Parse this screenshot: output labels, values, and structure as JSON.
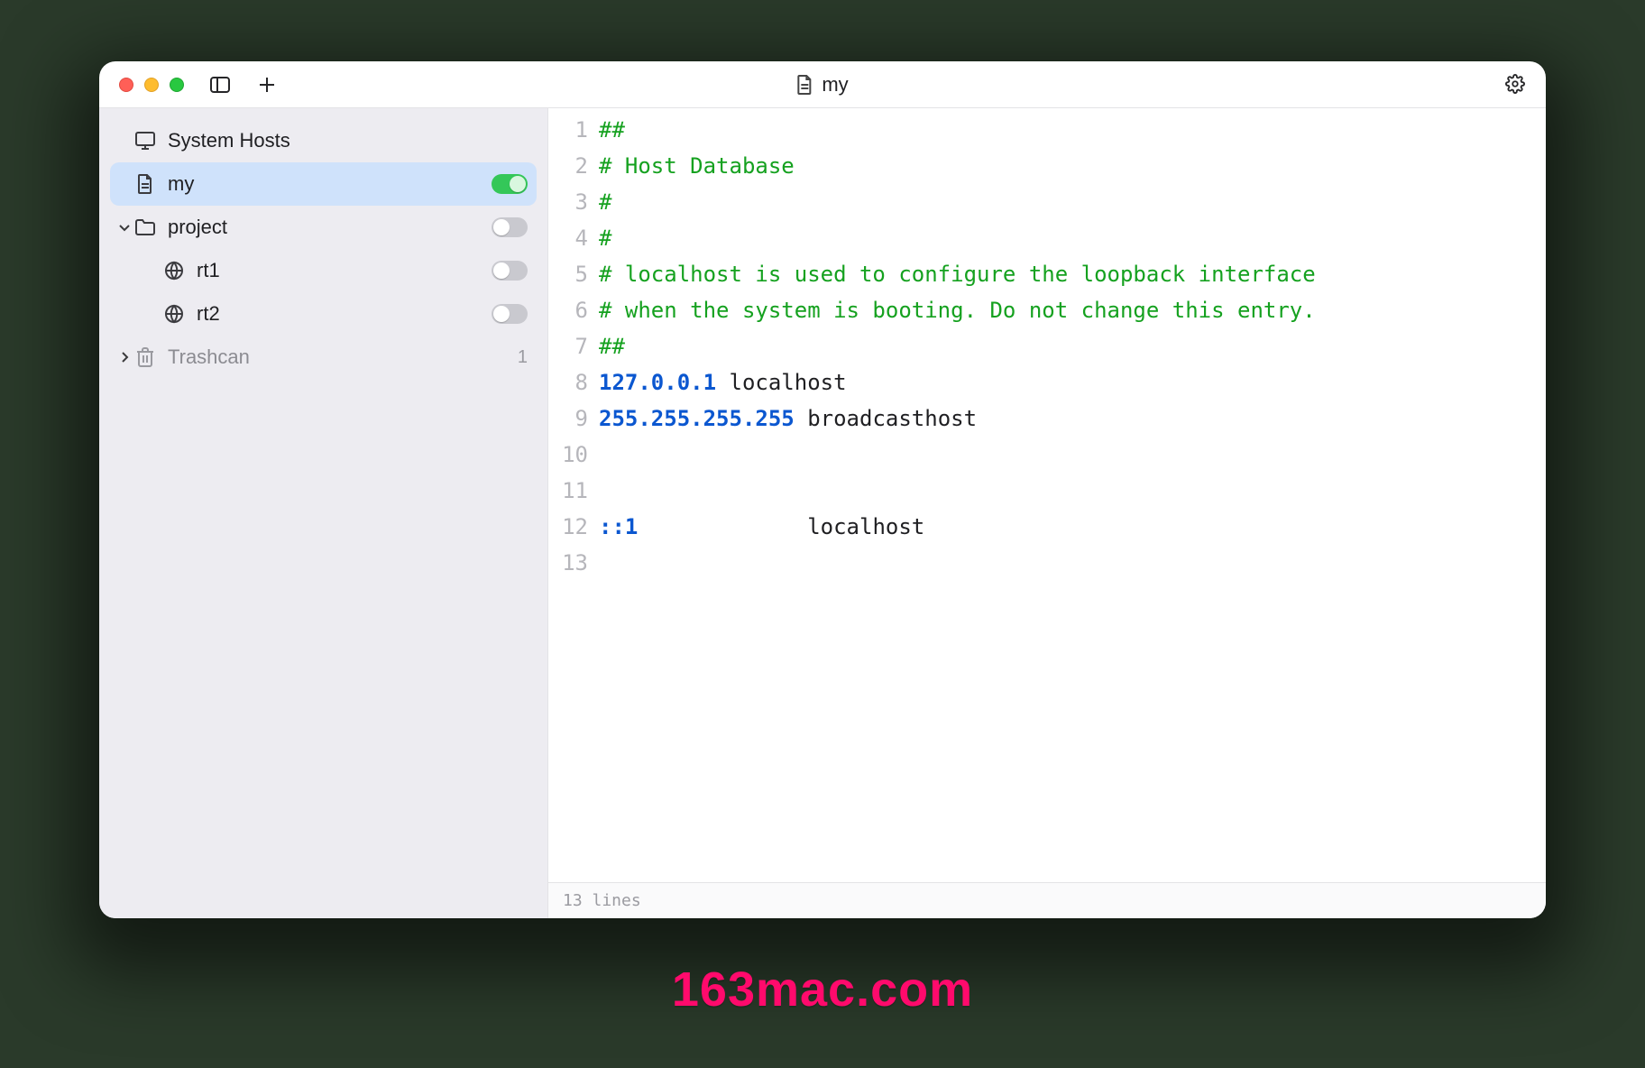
{
  "titlebar": {
    "title": "my"
  },
  "sidebar": {
    "items": [
      {
        "label": "System Hosts"
      },
      {
        "label": "my"
      },
      {
        "label": "project"
      },
      {
        "label": "rt1"
      },
      {
        "label": "rt2"
      },
      {
        "label": "Trashcan",
        "count": "1"
      }
    ]
  },
  "editor": {
    "lines": [
      {
        "n": "1",
        "tokens": [
          {
            "t": "comment",
            "v": "##"
          }
        ]
      },
      {
        "n": "2",
        "tokens": [
          {
            "t": "comment",
            "v": "# Host Database"
          }
        ]
      },
      {
        "n": "3",
        "tokens": [
          {
            "t": "comment",
            "v": "#"
          }
        ]
      },
      {
        "n": "4",
        "tokens": [
          {
            "t": "comment",
            "v": "#"
          }
        ]
      },
      {
        "n": "5",
        "tokens": [
          {
            "t": "comment",
            "v": "# localhost is used to configure the loopback interface"
          }
        ]
      },
      {
        "n": "6",
        "tokens": [
          {
            "t": "comment",
            "v": "# when the system is booting. Do not change this entry."
          }
        ]
      },
      {
        "n": "7",
        "tokens": [
          {
            "t": "comment",
            "v": "##"
          }
        ]
      },
      {
        "n": "8",
        "tokens": [
          {
            "t": "ip",
            "v": "127.0.0.1"
          },
          {
            "t": "text",
            "v": " localhost"
          }
        ]
      },
      {
        "n": "9",
        "tokens": [
          {
            "t": "ip",
            "v": "255.255.255.255"
          },
          {
            "t": "text",
            "v": " broadcasthost"
          }
        ]
      },
      {
        "n": "10",
        "tokens": []
      },
      {
        "n": "11",
        "tokens": []
      },
      {
        "n": "12",
        "tokens": [
          {
            "t": "ip",
            "v": "::1"
          },
          {
            "t": "text",
            "v": "             localhost"
          }
        ]
      },
      {
        "n": "13",
        "tokens": []
      }
    ]
  },
  "statusbar": {
    "text": "13 lines"
  },
  "watermark": "163mac.com"
}
